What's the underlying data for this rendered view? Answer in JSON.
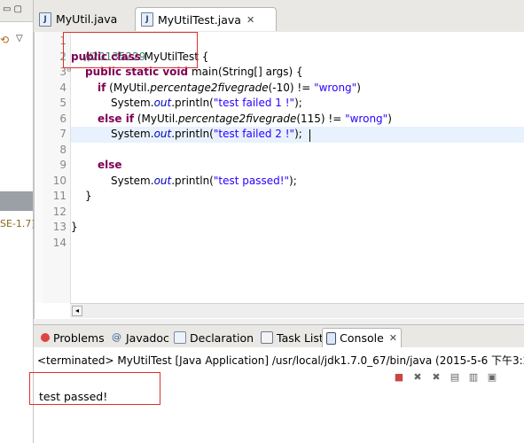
{
  "editor": {
    "tabs": [
      {
        "label": "MyUtil.java",
        "icon": "java-file-icon",
        "active": false
      },
      {
        "label": "MyUtilTest.java",
        "icon": "java-file-icon",
        "active": true
      }
    ],
    "line_numbers": [
      "1",
      "2",
      "3",
      "4",
      "5",
      "6",
      "7",
      "8",
      "9",
      "10",
      "11",
      "12",
      "13",
      "14"
    ],
    "code": {
      "l1_comment": "//20135229",
      "l2_kw": "public class",
      "l2_rest": " MyUtilTest {",
      "l3_kw": "public static void",
      "l3_rest": " main(String[] args) {",
      "l4_kw": "if",
      "l4_a": " (MyUtil.",
      "l4_method": "percentage2fivegrade",
      "l4_b": "(-10) != ",
      "l4_str": "\"wrong\"",
      "l4_c": ")",
      "l5_a": "System.",
      "l5_out": "out",
      "l5_b": ".println(",
      "l5_str": "\"test failed 1 !\"",
      "l5_c": ");",
      "l6_kw": "else if",
      "l6_a": " (MyUtil.",
      "l6_method": "percentage2fivegrade",
      "l6_b": "(115) != ",
      "l6_str": "\"wrong\"",
      "l6_c": ")",
      "l7_a": "System.",
      "l7_out": "out",
      "l7_b": ".println(",
      "l7_str": "\"test failed 2 !\"",
      "l7_c": ");",
      "l9_kw": "else",
      "l10_a": "System.",
      "l10_out": "out",
      "l10_b": ".println(",
      "l10_str": "\"test passed!\"",
      "l10_c": ");",
      "l11": "}",
      "l13": "}"
    }
  },
  "left_panel": {
    "jre_label": "SE-1.7]"
  },
  "bottom_panel": {
    "tabs": [
      {
        "label": "Problems",
        "icon": "problems-icon"
      },
      {
        "label": "Javadoc",
        "icon": "javadoc-icon"
      },
      {
        "label": "Declaration",
        "icon": "declaration-icon"
      },
      {
        "label": "Task List",
        "icon": "tasklist-icon"
      },
      {
        "label": "Console",
        "icon": "console-icon",
        "active": true
      }
    ],
    "console_description": "<terminated> MyUtilTest [Java Application] /usr/local/jdk1.7.0_67/bin/java (2015-5-6 下午3:2",
    "console_output": "test passed!"
  },
  "colors": {
    "keyword": "#7f0055",
    "string": "#2a00ff",
    "comment": "#3f7f5f",
    "field": "#0000c0",
    "highlight_box": "#e0302a",
    "current_line": "#e8f2fe"
  }
}
